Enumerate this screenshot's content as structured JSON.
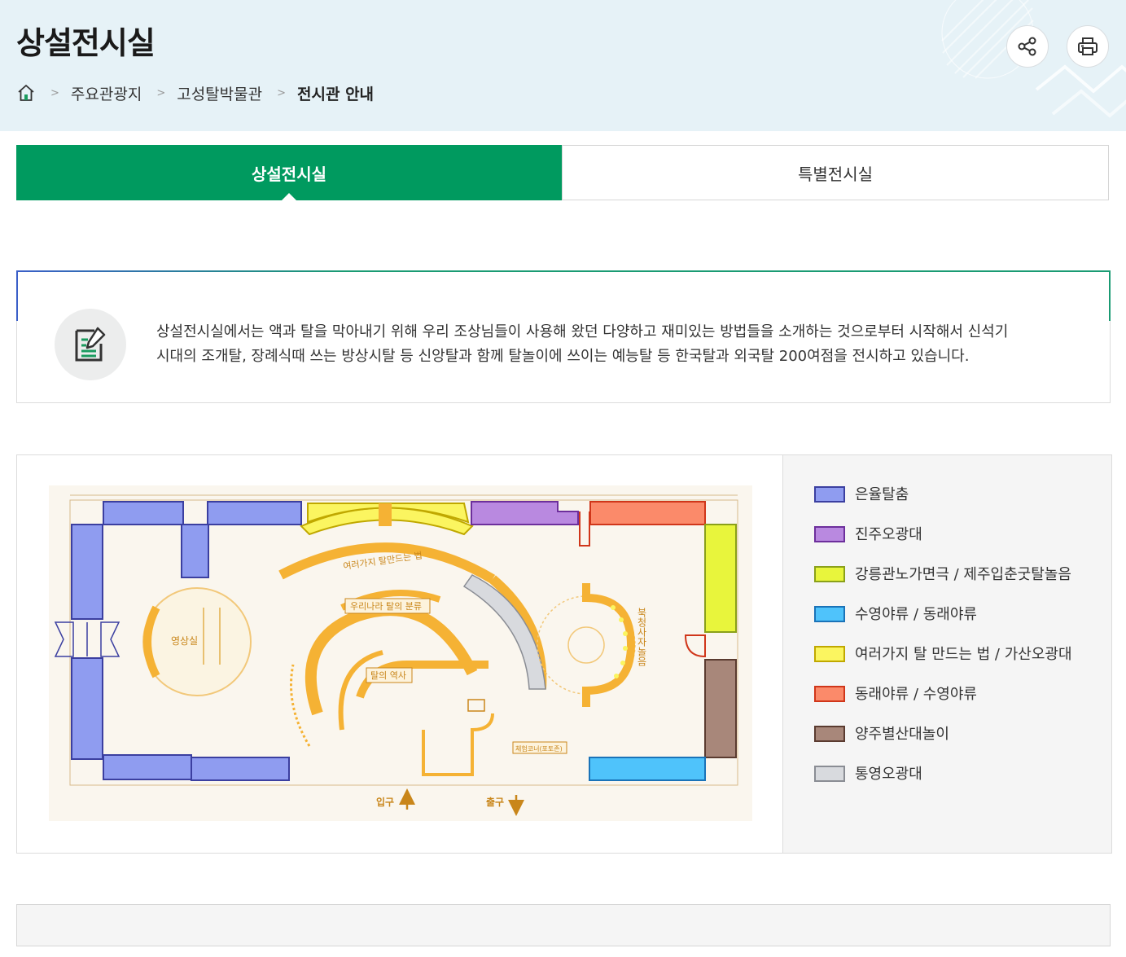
{
  "header": {
    "title": "상설전시실",
    "breadcrumb": {
      "home_icon": "home-icon",
      "items": [
        "주요관광지",
        "고성탈박물관",
        "전시관 안내"
      ]
    },
    "actions": {
      "share_icon": "share-icon",
      "print_icon": "print-icon"
    }
  },
  "tabs": [
    {
      "label": "상설전시실",
      "active": true
    },
    {
      "label": "특별전시실",
      "active": false
    }
  ],
  "intro": {
    "icon": "document-edit-icon",
    "text_line1": "상설전시실에서는 액과 탈을 막아내기 위해 우리 조상님들이 사용해 왔던 다양하고 재미있는 방법들을 소개하는 것으로부터 시작해서 신석기",
    "text_line2": "시대의 조개탈, 장례식때 쓰는 방상시탈 등 신앙탈과 함께 탈놀이에 쓰이는 예능탈 등 한국탈과 외국탈 200여점을 전시하고 있습니다."
  },
  "floorplan": {
    "labels": {
      "video_room": "영상실",
      "mask_making": "여러가지 탈만드는 법",
      "classification": "우리나라 탈의 분류",
      "history": "탈의 역사",
      "play_area": "북청사자놀음",
      "experience": "체험코너(포토존)",
      "entrance": "입구",
      "exit": "출구"
    }
  },
  "legend": [
    {
      "label": "은율탈춤",
      "color": "#8f9cf0",
      "border": "#3b3fa0"
    },
    {
      "label": "진주오광대",
      "color": "#b989e0",
      "border": "#6d2f9c"
    },
    {
      "label": "강릉관노가면극 / 제주입춘굿탈놀음",
      "color": "#e8f53c",
      "border": "#8aa01a"
    },
    {
      "label": "수영야류 / 동래야류",
      "color": "#4fc3fb",
      "border": "#1a73b8"
    },
    {
      "label": "여러가지 탈 만드는 법 / 가산오광대",
      "color": "#fbf560",
      "border": "#c0a800"
    },
    {
      "label": "동래야류 / 수영야류",
      "color": "#fb8a6a",
      "border": "#d0361a"
    },
    {
      "label": "양주별산대놀이",
      "color": "#a8877a",
      "border": "#5a3b30"
    },
    {
      "label": "통영오광대",
      "color": "#d8dade",
      "border": "#8a8d94"
    }
  ]
}
